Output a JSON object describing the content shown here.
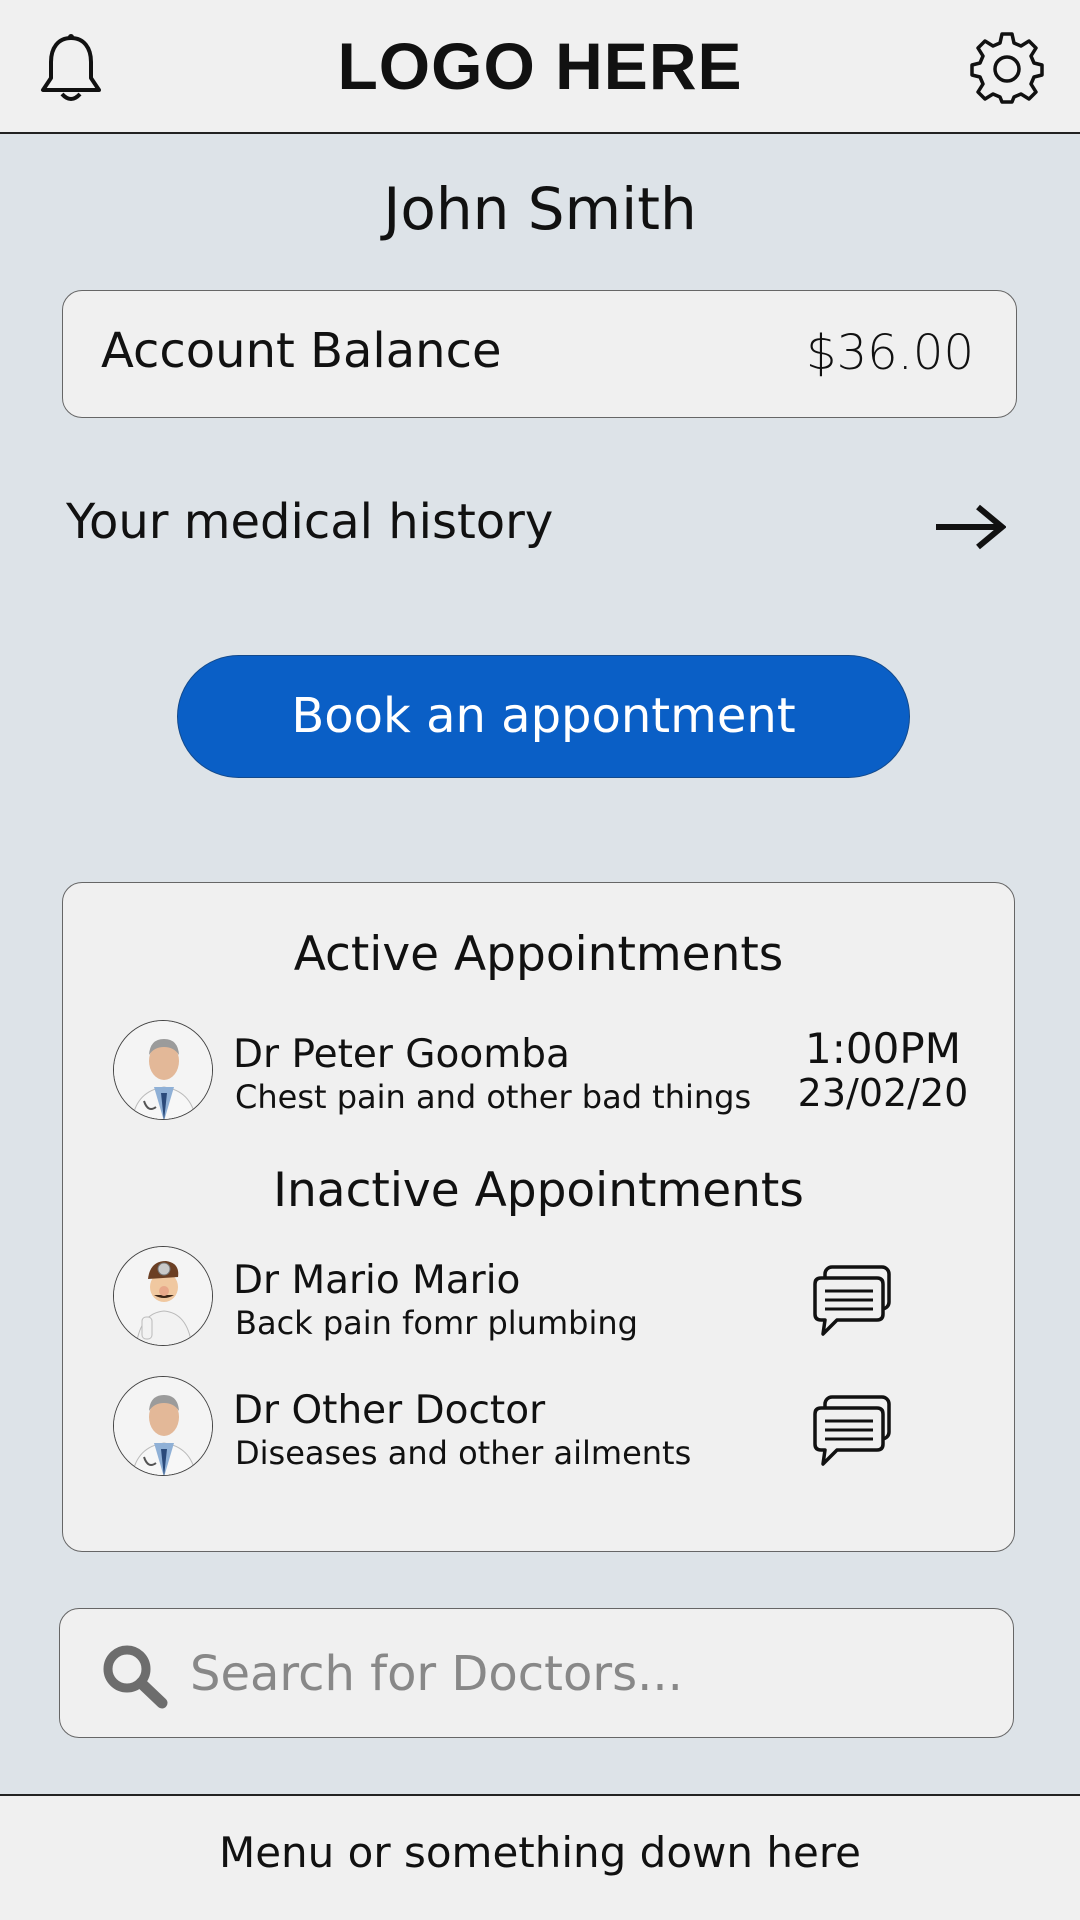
{
  "header": {
    "logo": "LOGO HERE",
    "left_icon": "bell-icon",
    "right_icon": "gear-icon"
  },
  "user": {
    "name": "John Smith"
  },
  "balance": {
    "label": "Account Balance",
    "value": "$36.00"
  },
  "history": {
    "label": "Your medical history",
    "icon": "arrow-right-icon"
  },
  "book_button": {
    "label": "Book an appontment",
    "color": "#0a5fc6"
  },
  "appointments": {
    "active_title": "Active Appointments",
    "active": [
      {
        "doctor": "Dr Peter Goomba",
        "description": "Chest pain and other bad things",
        "time": "1:00PM",
        "date": "23/02/20"
      }
    ],
    "inactive_title": "Inactive Appointments",
    "inactive": [
      {
        "doctor": "Dr Mario Mario",
        "description": "Back pain fomr plumbing",
        "icon": "chat-icon"
      },
      {
        "doctor": "Dr Other Doctor",
        "description": "Diseases and other ailments",
        "icon": "chat-icon"
      }
    ]
  },
  "search": {
    "placeholder": "Search for Doctors...",
    "icon": "search-icon"
  },
  "footer": {
    "text": "Menu or something down here"
  }
}
